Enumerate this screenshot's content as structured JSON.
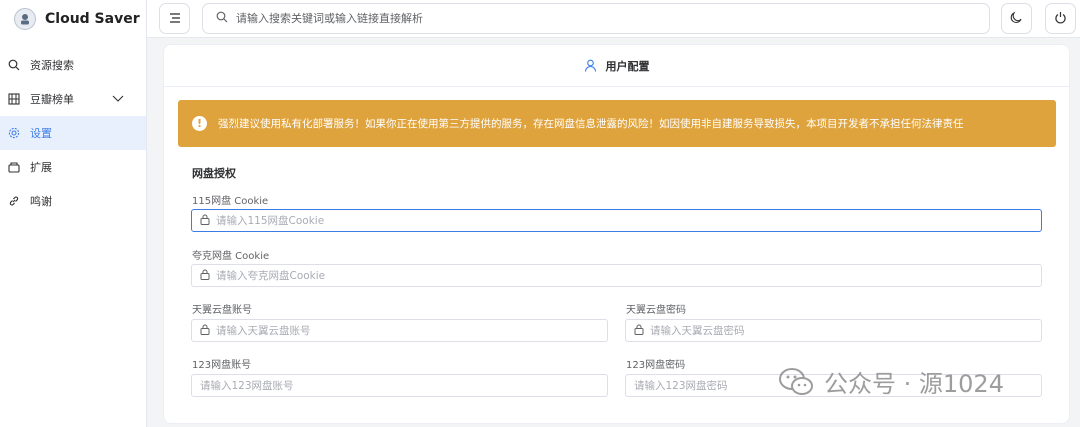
{
  "app": {
    "title": "Cloud Saver"
  },
  "sidebar": {
    "items": [
      {
        "label": "资源搜索",
        "icon": "search-icon"
      },
      {
        "label": "豆瓣榜单",
        "icon": "film-icon",
        "has_submenu": true
      },
      {
        "label": "设置",
        "icon": "settings-icon",
        "active": true
      },
      {
        "label": "扩展",
        "icon": "extension-icon"
      },
      {
        "label": "鸣谢",
        "icon": "link-icon"
      }
    ]
  },
  "header": {
    "search_placeholder": "请输入搜索关键词或输入链接直接解析"
  },
  "card": {
    "title": "用户配置",
    "alert": "强烈建议使用私有化部署服务！如果你正在使用第三方提供的服务，存在网盘信息泄露的风险！如因使用非自建服务导致损失，本项目开发者不承担任何法律责任",
    "section_title": "网盘授权",
    "fields": {
      "cookie115": {
        "label": "115网盘 Cookie",
        "placeholder": "请输入115网盘Cookie"
      },
      "quark": {
        "label": "夸克网盘 Cookie",
        "placeholder": "请输入夸克网盘Cookie"
      },
      "tianyi_account": {
        "label": "天翼云盘账号",
        "placeholder": "请输入天翼云盘账号"
      },
      "tianyi_password": {
        "label": "天翼云盘密码",
        "placeholder": "请输入天翼云盘密码"
      },
      "pan123_account": {
        "label": "123网盘账号",
        "placeholder": "请输入123网盘账号"
      },
      "pan123_password": {
        "label": "123网盘密码",
        "placeholder": "请输入123网盘密码"
      }
    }
  },
  "watermark": {
    "text": "公众号 · 源1024"
  },
  "colors": {
    "accent": "#3b7de8",
    "warning": "#dfa33d",
    "active_bg": "#e9f0fd"
  }
}
